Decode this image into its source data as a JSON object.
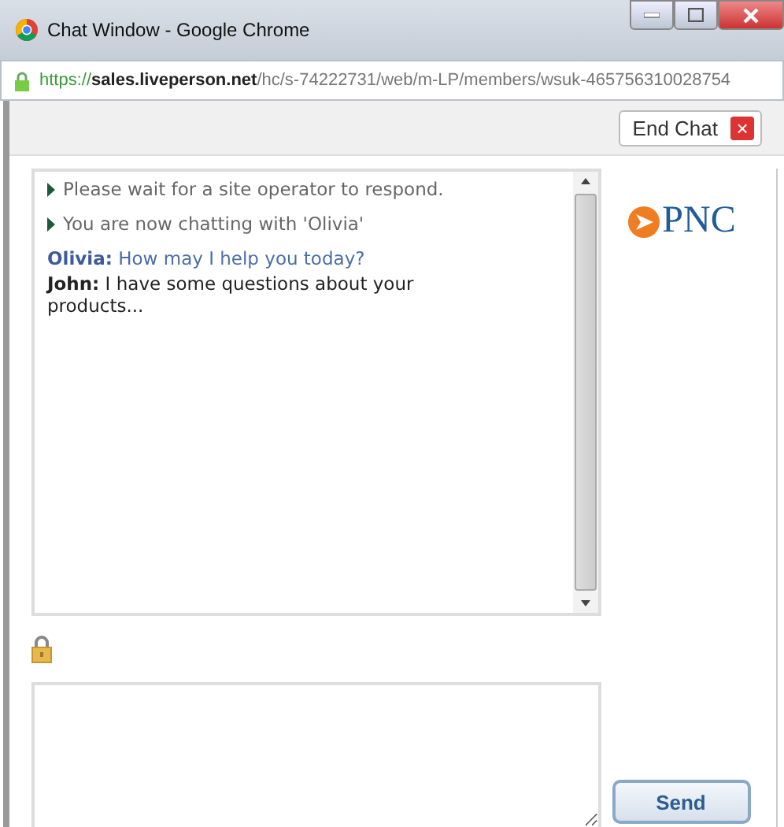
{
  "window": {
    "title": "Chat Window - Google Chrome"
  },
  "address_bar": {
    "scheme": "https://",
    "host": "sales.liveperson.net",
    "path": "/hc/s-74222731/web/m-LP/members/wsuk-465756310028754"
  },
  "toolbar": {
    "end_chat": "End Chat",
    "close_glyph": "×"
  },
  "messages": [
    {
      "kind": "system",
      "text": "Please wait for a site operator to respond."
    },
    {
      "kind": "system",
      "text": "You are now chatting with 'Olivia'"
    },
    {
      "kind": "operator",
      "sender": "Olivia:",
      "text": "How may I help you today?"
    },
    {
      "kind": "visitor",
      "sender": "John:",
      "text": "I have some questions about your products..."
    }
  ],
  "logo": {
    "text": "PNC"
  },
  "send_button": "Send"
}
